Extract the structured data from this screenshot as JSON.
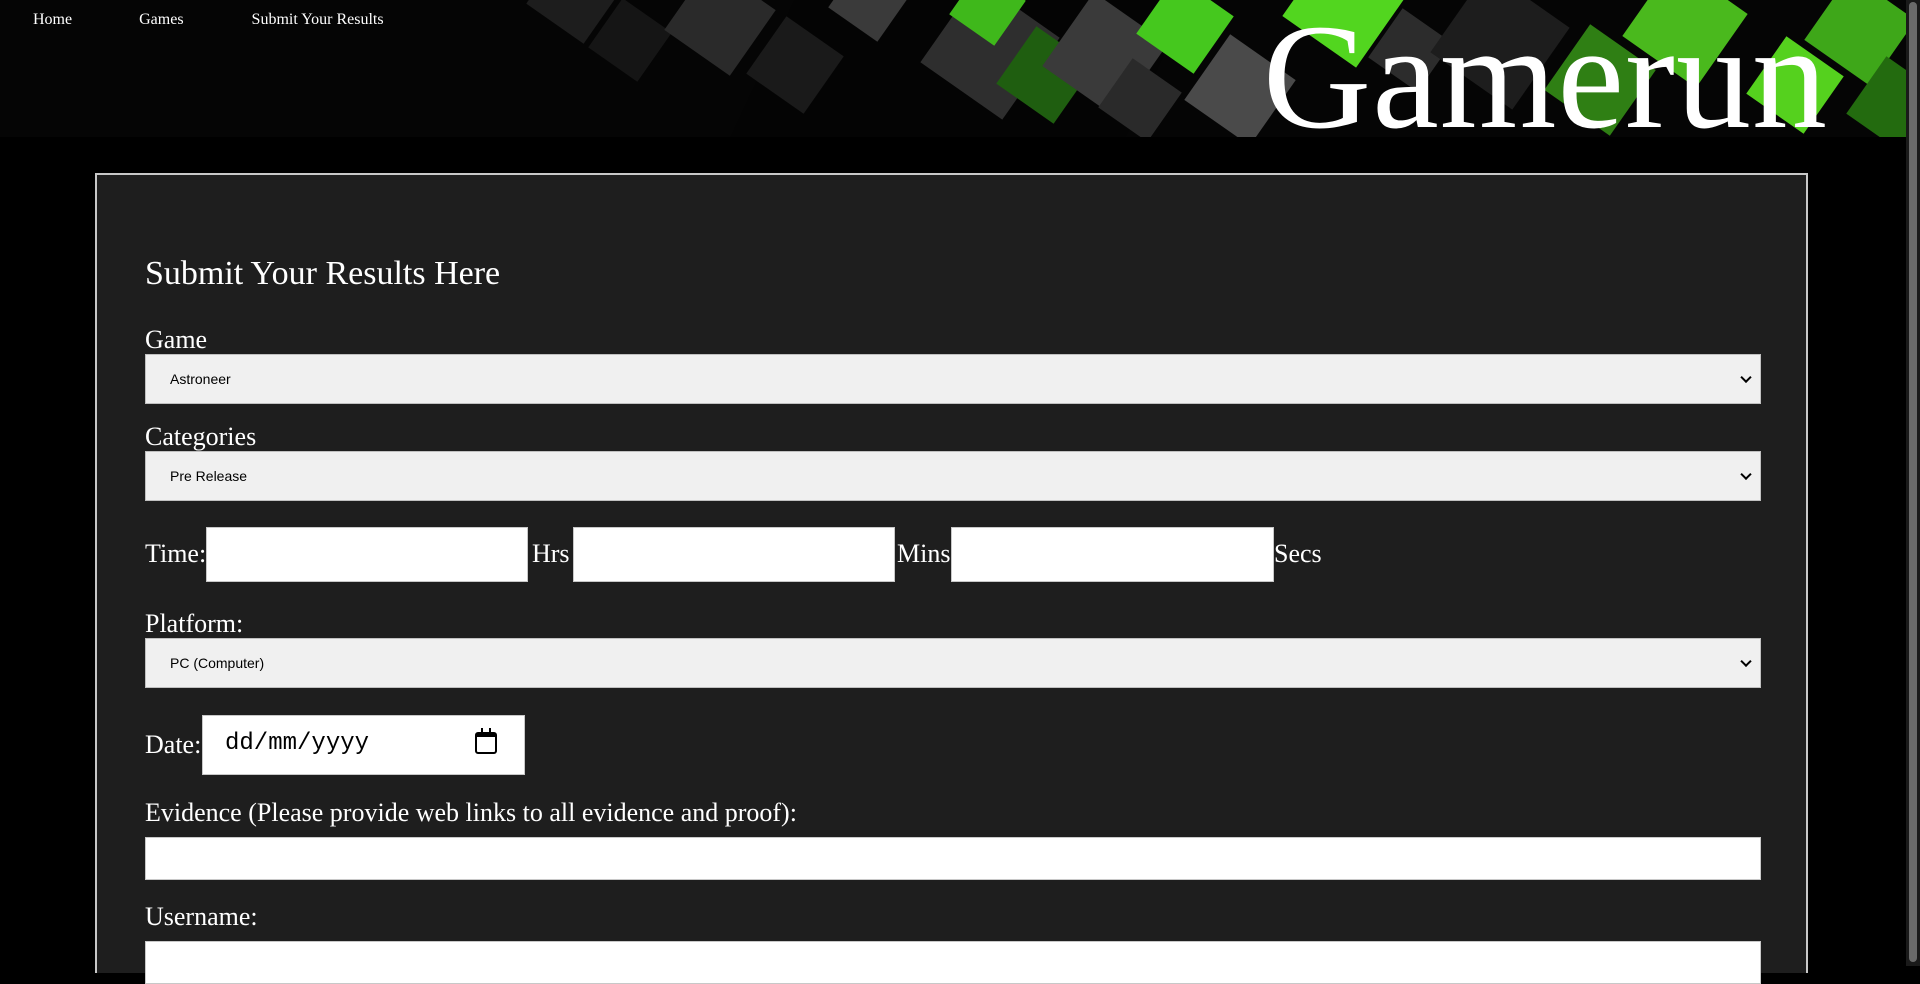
{
  "nav": {
    "home": "Home",
    "games": "Games",
    "submit": "Submit Your Results"
  },
  "brand": "Gamerun",
  "colors": {
    "accent": "#45c81e",
    "panel_bg": "#1e1e1e",
    "page_bg": "#000000"
  },
  "form": {
    "title": "Submit Your Results Here",
    "game_label": "Game",
    "game_value": "Astroneer",
    "categories_label": "Categories",
    "categories_value": "Pre Release",
    "time_label": "Time:",
    "hrs_label": "Hrs",
    "mins_label": "Mins",
    "secs_label": "Secs",
    "platform_label": "Platform:",
    "platform_value": "PC (Computer)",
    "date_label": "Date:",
    "date_placeholder": "dd/mm/yyyy",
    "evidence_label": "Evidence (Please provide web links to all evidence and proof):",
    "username_label": "Username:"
  }
}
